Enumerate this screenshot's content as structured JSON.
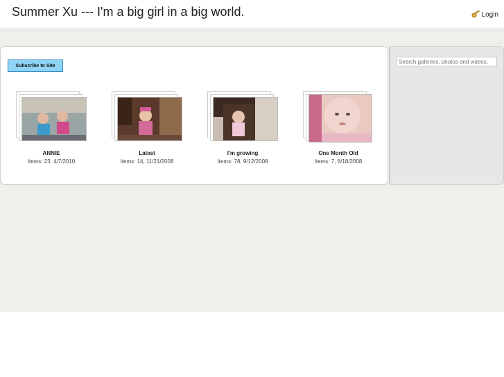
{
  "header": {
    "title": "Summer Xu --- I'm a big girl in a big world.",
    "login_label": "Login",
    "login_icon": "key-icon"
  },
  "subscribe_label": "Subscribe to Site",
  "search": {
    "placeholder": "Search galleries, photos and videos."
  },
  "albums": [
    {
      "title": "ANNIE",
      "meta": "Items: 23, 4/7/2010",
      "photo_colors": [
        "#7a8b8f",
        "#c9c2b6"
      ]
    },
    {
      "title": "Latest",
      "meta": "Items: 14, 11/21/2008",
      "photo_colors": [
        "#5a3a2a",
        "#d46a9a"
      ]
    },
    {
      "title": "I'm growing",
      "meta": "Items: 78, 9/12/2008",
      "photo_colors": [
        "#3c2a22",
        "#e6c3b0"
      ]
    },
    {
      "title": "One Month Old",
      "meta": "Items: 7, 8/18/2008",
      "photo_colors": [
        "#d4a79a",
        "#f1d5cf"
      ]
    }
  ]
}
